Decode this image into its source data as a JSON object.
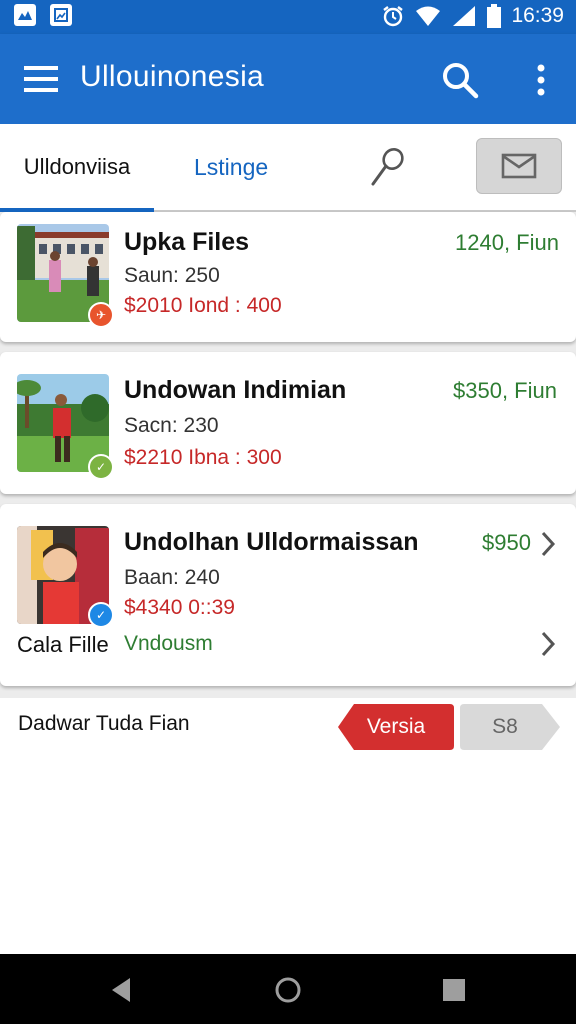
{
  "status_bar": {
    "time": "16:39"
  },
  "app_bar": {
    "title": "Ullouinonesia"
  },
  "tabs": [
    {
      "label": "Ulldonviisa"
    },
    {
      "label": "Lstinge"
    }
  ],
  "cards": [
    {
      "title": "Upka Files",
      "subtitle": "Saun: 250",
      "price": "$2010 Iond : 400",
      "right": "1240, Fiun"
    },
    {
      "title": "Undowan Indimian",
      "subtitle": "Sacn: 230",
      "price": "$2210 Ibna : 300",
      "right": "$350, Fiun"
    },
    {
      "title": "Undolhan Ulldormaissan",
      "subtitle": "Baan: 240",
      "price": "$4340 0::39",
      "right": "$950",
      "extra_label": "Cala Fille",
      "extra_value": "Vndousm"
    }
  ],
  "footer": {
    "label": "Dadwar Tuda Fian",
    "tag_primary": "Versia",
    "tag_secondary": "S8"
  },
  "colors": {
    "primary": "#1e6ecb",
    "price_red": "#c62828",
    "accent_green": "#2e7d32",
    "tag_red": "#d32f2f"
  }
}
